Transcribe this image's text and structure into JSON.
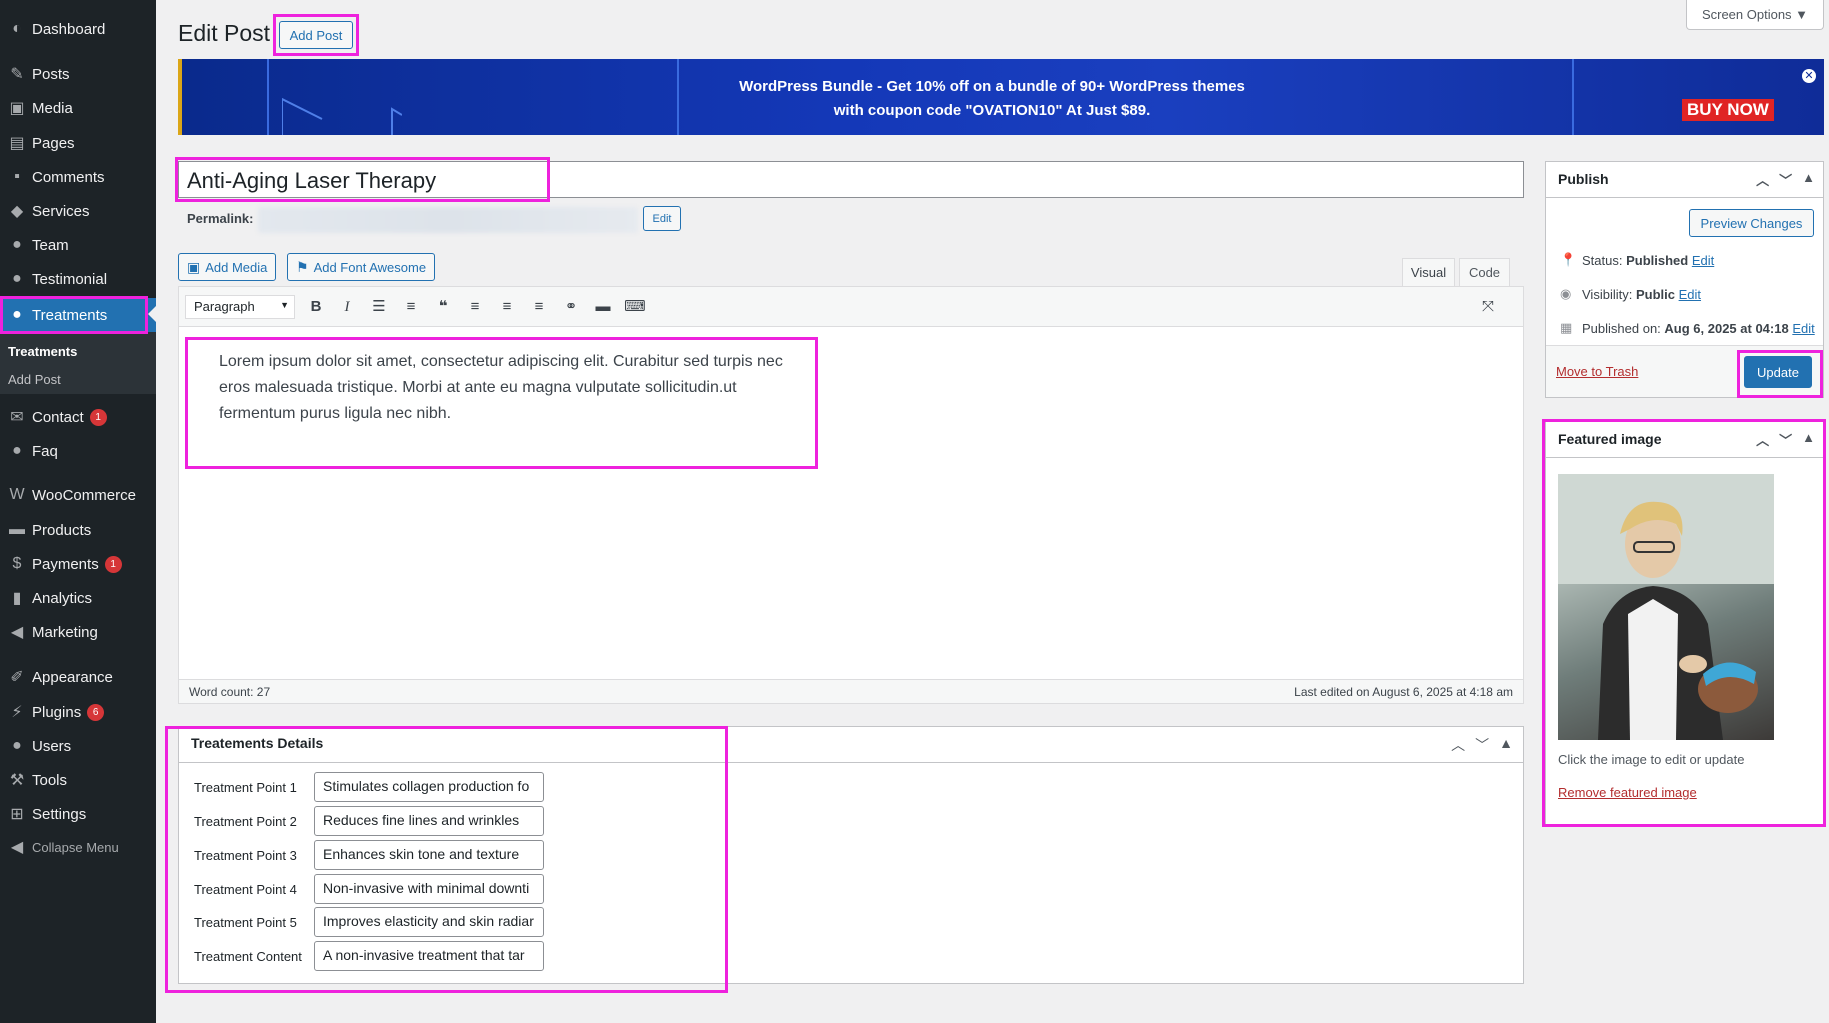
{
  "sidebar": {
    "items": [
      {
        "label": "Dashboard",
        "icon": "dashboard-icon",
        "glyph": "◐"
      },
      {
        "label": "Posts",
        "icon": "pin-icon",
        "glyph": "✎"
      },
      {
        "label": "Media",
        "icon": "media-icon",
        "glyph": "▣"
      },
      {
        "label": "Pages",
        "icon": "pages-icon",
        "glyph": "▤"
      },
      {
        "label": "Comments",
        "icon": "comments-icon",
        "glyph": "▪"
      },
      {
        "label": "Services",
        "icon": "tag-icon",
        "glyph": "◆"
      },
      {
        "label": "Team",
        "icon": "users-icon",
        "glyph": "●"
      },
      {
        "label": "Testimonial",
        "icon": "users-icon",
        "glyph": "●"
      },
      {
        "label": "Treatments",
        "icon": "users-icon",
        "glyph": "●"
      },
      {
        "label": "Contact",
        "icon": "mail-icon",
        "glyph": "✉",
        "badge": "1"
      },
      {
        "label": "Faq",
        "icon": "users-icon",
        "glyph": "●"
      },
      {
        "label": "WooCommerce",
        "icon": "woocommerce-icon",
        "glyph": "W"
      },
      {
        "label": "Products",
        "icon": "archive-icon",
        "glyph": "▬"
      },
      {
        "label": "Payments",
        "icon": "dollar-icon",
        "glyph": "$",
        "badge": "1"
      },
      {
        "label": "Analytics",
        "icon": "chart-icon",
        "glyph": "▮"
      },
      {
        "label": "Marketing",
        "icon": "megaphone-icon",
        "glyph": "◀"
      },
      {
        "label": "Appearance",
        "icon": "brush-icon",
        "glyph": "✐"
      },
      {
        "label": "Plugins",
        "icon": "plug-icon",
        "glyph": "⚡",
        "badge": "6"
      },
      {
        "label": "Users",
        "icon": "user-icon",
        "glyph": "●"
      },
      {
        "label": "Tools",
        "icon": "wrench-icon",
        "glyph": "⚒"
      },
      {
        "label": "Settings",
        "icon": "settings-icon",
        "glyph": "⊞"
      },
      {
        "label": "Collapse Menu",
        "icon": "collapse-icon",
        "glyph": "◀"
      }
    ],
    "submenu": [
      "Treatments",
      "Add Post"
    ]
  },
  "header": {
    "title": "Edit Post",
    "add_post": "Add Post",
    "screen_options": "Screen Options ▼"
  },
  "banner": {
    "line1": "WordPress Bundle - Get 10% off on a bundle of 90+ WordPress themes",
    "line2": "with coupon code \"OVATION10\" At Just $89.",
    "buy_now": "BUY NOW",
    "close": "✕"
  },
  "post": {
    "title": "Anti-Aging Laser Therapy",
    "permalink_label": "Permalink:",
    "permalink_edit": "Edit"
  },
  "editor": {
    "add_media": "Add Media",
    "add_font_awesome": "Add Font Awesome",
    "tab_visual": "Visual",
    "tab_code": "Code",
    "format": "Paragraph",
    "content": "Lorem ipsum dolor sit amet, consectetur adipiscing elit. Curabitur sed turpis nec eros malesuada tristique. Morbi at ante eu magna vulputate sollicitudin.ut fermentum purus ligula nec nibh.",
    "word_count": "Word count: 27",
    "last_edited": "Last edited on August 6, 2025 at 4:18 am"
  },
  "meta": {
    "title": "Treatements Details",
    "rows": [
      {
        "label": "Treatment Point 1",
        "value": "Stimulates collagen production fo"
      },
      {
        "label": "Treatment Point 2",
        "value": "Reduces fine lines and wrinkles"
      },
      {
        "label": "Treatment Point 3",
        "value": "Enhances skin tone and texture"
      },
      {
        "label": "Treatment Point 4",
        "value": "Non-invasive with minimal downti"
      },
      {
        "label": "Treatment Point 5",
        "value": "Improves elasticity and skin radiar"
      },
      {
        "label": "Treatment Content",
        "value": "A non-invasive treatment that tar"
      }
    ]
  },
  "publish": {
    "title": "Publish",
    "preview": "Preview Changes",
    "status_label": "Status:",
    "status_value": "Published",
    "visibility_label": "Visibility:",
    "visibility_value": "Public",
    "published_label": "Published on:",
    "published_value": "Aug 6, 2025 at 04:18",
    "edit": "Edit",
    "trash": "Move to Trash",
    "update": "Update"
  },
  "featured": {
    "title": "Featured image",
    "hint": "Click the image to edit or update",
    "remove": "Remove featured image"
  },
  "colors": {
    "sidebar_bg": "#1d2327",
    "accent": "#2271b1",
    "highlight": "#ee22dd",
    "badge": "#d63638"
  }
}
